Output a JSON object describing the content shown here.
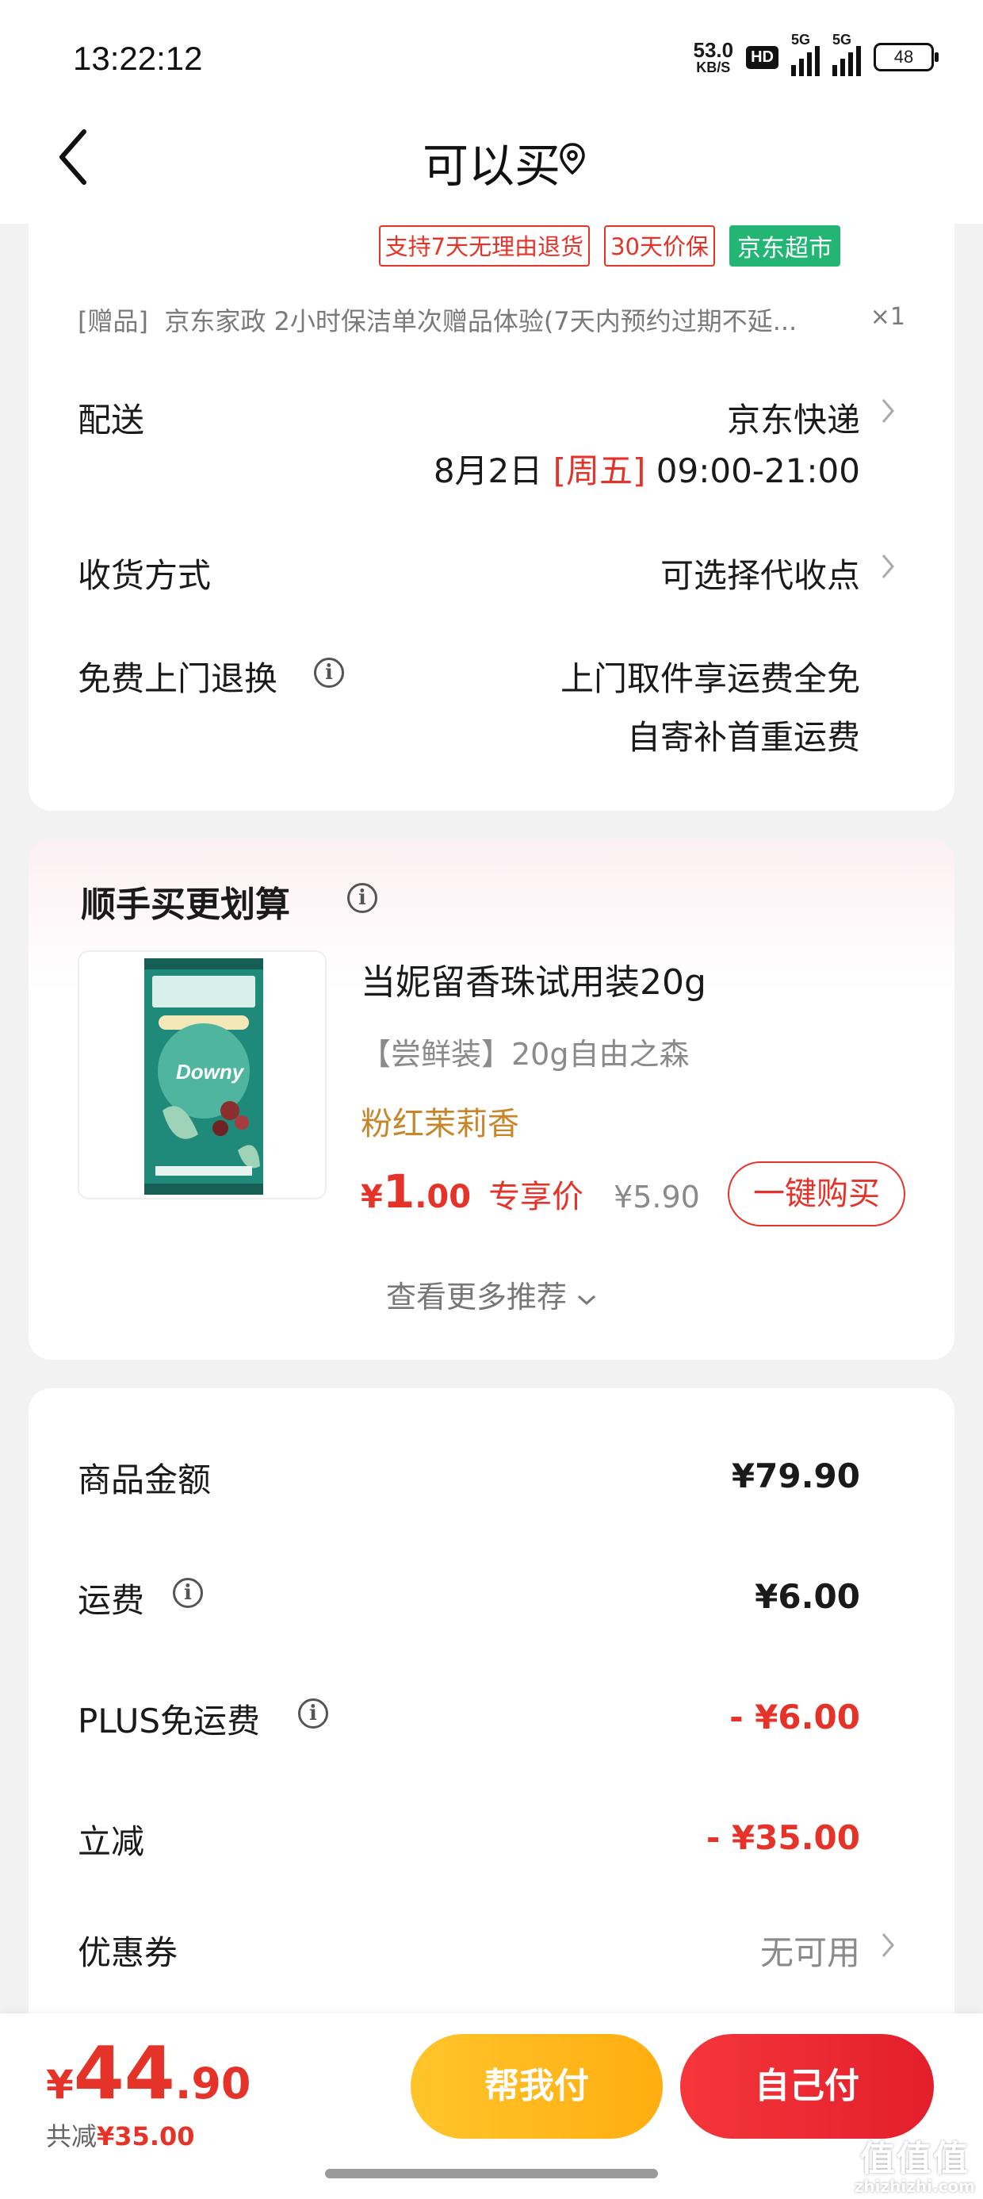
{
  "status_bar": {
    "time": "13:22:12",
    "net_speed_value": "53.0",
    "net_speed_unit": "KB/S",
    "hd_badge": "HD",
    "sim1": "5G",
    "sim2": "5G",
    "battery": "48"
  },
  "nav": {
    "title": "可以买",
    "back_icon": "chevron-left-icon",
    "location_icon": "location-pin-icon"
  },
  "order": {
    "tags": [
      "支持7天无理由退货",
      "30天价保"
    ],
    "store_tag": "京东超市",
    "gift_label": "[赠品]",
    "gift_text": "京东家政 2小时保洁单次赠品体验(7天内预约过期不延...",
    "gift_qty": "×1",
    "delivery": {
      "label": "配送",
      "method": "京东快递",
      "date": "8月2日",
      "weekday": "[周五]",
      "time": "09:00-21:00"
    },
    "receive": {
      "label": "收货方式",
      "value": "可选择代收点"
    },
    "free_return": {
      "label": "免费上门退换",
      "line1": "上门取件享运费全免",
      "line2": "自寄补首重运费"
    }
  },
  "recommend": {
    "title": "顺手买更划算",
    "product": {
      "name": "当妮留香珠试用装20g",
      "spec": "【尝鲜装】20g自由之森",
      "scent": "粉红茉莉香",
      "price_currency": "¥",
      "price_int": "1",
      "price_dec": ".00",
      "price_label": "专享价",
      "original_price": "¥5.90",
      "buy_label": "一键购买",
      "image_brand": "Downy"
    },
    "more_label": "查看更多推荐"
  },
  "summary": {
    "goods_amount": {
      "label": "商品金额",
      "value": "¥79.90"
    },
    "shipping": {
      "label": "运费",
      "value": "¥6.00"
    },
    "plus_free_shipping": {
      "label": "PLUS免运费",
      "value": "- ¥6.00"
    },
    "instant_discount": {
      "label": "立减",
      "value": "- ¥35.00"
    },
    "coupon": {
      "label": "优惠券",
      "value": "无可用"
    }
  },
  "footer": {
    "total_currency": "¥",
    "total_int": "44",
    "total_dec": ".90",
    "saved_label": "共减",
    "saved_amount": "¥35.00",
    "help_pay_label": "帮我付",
    "self_pay_label": "自己付",
    "watermark_big": "值值值",
    "watermark_small": "zhizhizhi.com"
  },
  "colors": {
    "accent_red": "#e6332a",
    "store_green": "#22b573",
    "gold": "#c8852a",
    "help_btn": "#ffb81c",
    "self_btn": "#ea2a33"
  }
}
